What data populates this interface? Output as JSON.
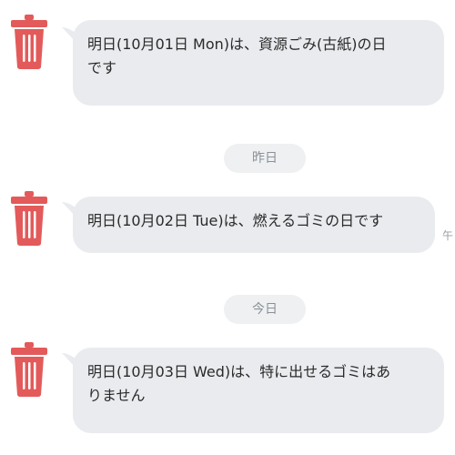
{
  "colors": {
    "accent_trash": "#e35a5a",
    "bubble_bg": "#e9ebee",
    "pill_bg": "#eef0f2",
    "text": "#2a2a2a",
    "muted_text": "#8c9096"
  },
  "messages": [
    {
      "avatar_icon": "trash-can-icon",
      "text_line1": "明日(10月01日 Mon)は、資源ごみ(古紙)の日",
      "text_line2": "です"
    },
    {
      "avatar_icon": "trash-can-icon",
      "text_line1": "明日(10月02日 Tue)は、燃えるゴミの日です",
      "time_fragment": "午"
    },
    {
      "avatar_icon": "trash-can-icon",
      "text_line1": "明日(10月03日 Wed)は、特に出せるゴミはあ",
      "text_line2": "りません"
    }
  ],
  "date_separators": [
    {
      "label": "昨日"
    },
    {
      "label": "今日"
    }
  ]
}
